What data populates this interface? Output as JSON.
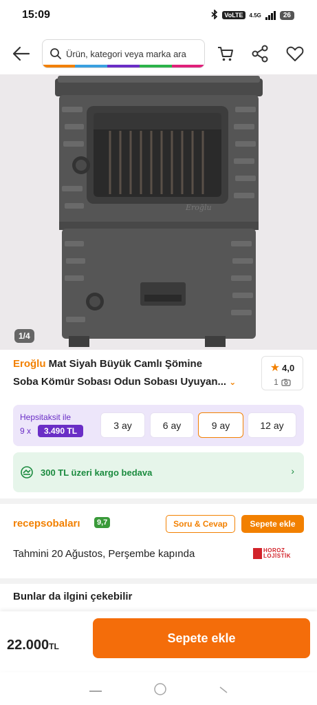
{
  "status": {
    "time": "15:09",
    "volte": "VoLTE",
    "network": "4.5G",
    "battery": "26"
  },
  "header": {
    "search_placeholder": "Ürün, kategori veya marka ara",
    "stripe_colors": [
      "#f28000",
      "#3aa0e0",
      "#6a2ec6",
      "#2cb34a",
      "#e0207a"
    ]
  },
  "gallery": {
    "counter": "1/4",
    "stove_logo": "Eroğlu"
  },
  "product": {
    "brand": "Eroğlu",
    "title_rest": "Mat Siyah Büyük Camlı Şömine",
    "title_line2": "Soba Kömür Sobası Odun Sobası Uyuyan...",
    "rating": "4,0",
    "photo_count": "1"
  },
  "installment": {
    "label": "Hepsitaksit ile",
    "times": "9 x",
    "price": "3.490 TL",
    "options": [
      "3 ay",
      "6 ay",
      "9 ay",
      "12 ay"
    ],
    "selected": "9 ay"
  },
  "cargo": {
    "text": "300 TL üzeri kargo bedava"
  },
  "seller": {
    "name": "recepsobaları",
    "score": "9,7",
    "qa_label": "Soru & Cevap",
    "add_label": "Sepete ekle"
  },
  "delivery": {
    "text": "Tahmini 20 Ağustos, Perşembe kapında",
    "carrier_line1": "HOROZ",
    "carrier_line2": "LOJİSTİK"
  },
  "related": {
    "title": "Bunlar da ilgini çekebilir"
  },
  "bottom": {
    "price": "22.000",
    "currency": "TL",
    "cart_label": "Sepete ekle"
  },
  "colors": {
    "accent": "#f28000",
    "purple": "#6a2ec6",
    "green": "#1a8a3e"
  }
}
